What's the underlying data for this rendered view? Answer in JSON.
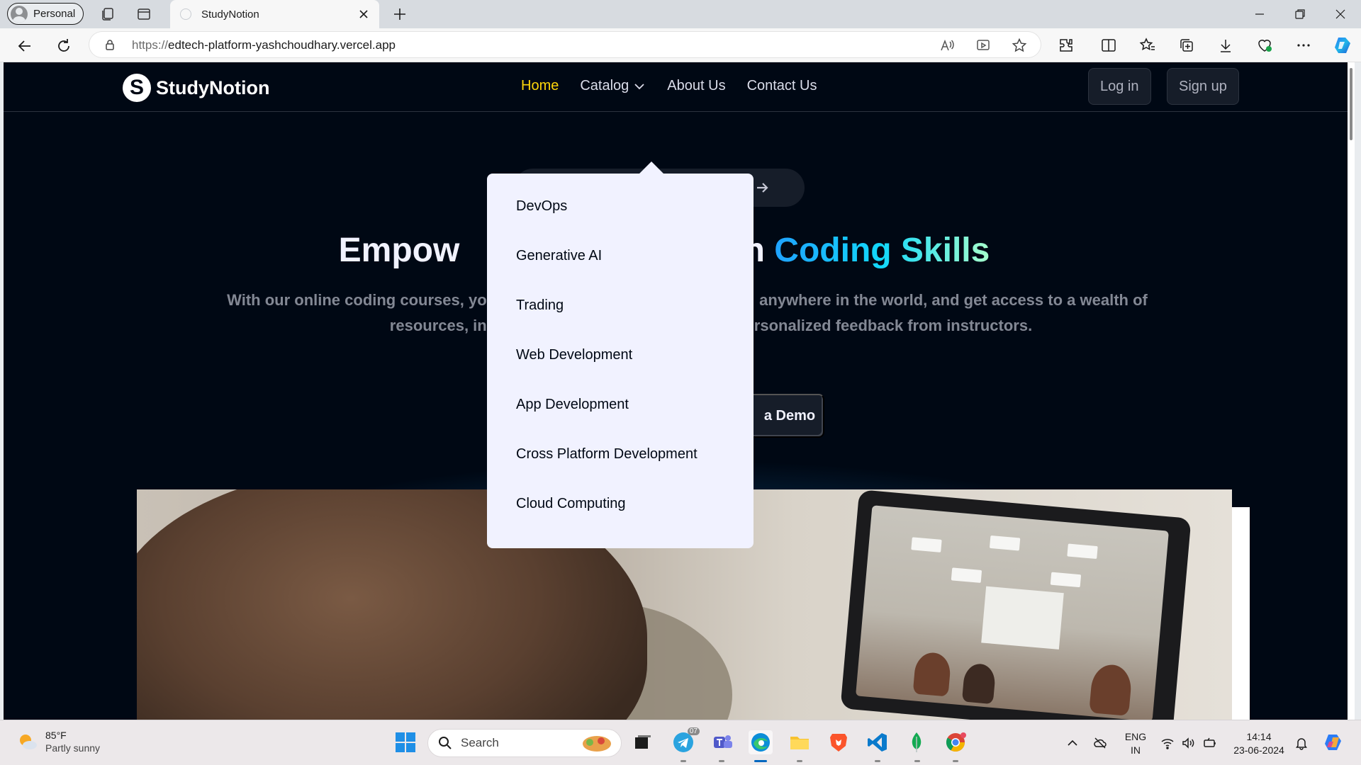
{
  "browser": {
    "profile_label": "Personal",
    "tab_title": "StudyNotion",
    "url_protocol": "https://",
    "url_host": "edtech-platform-yashchoudhary.vercel.app"
  },
  "site": {
    "logo_letter": "S",
    "brand_name": "StudyNotion",
    "nav": {
      "home": "Home",
      "catalog": "Catalog",
      "about": "About Us",
      "contact": "Contact Us"
    },
    "login_label": "Log in",
    "signup_label": "Sign up"
  },
  "catalog_menu": [
    "DevOps",
    "Generative AI",
    "Trading",
    "Web Development",
    "App Development",
    "Cross Platform Development",
    "Cloud Computing"
  ],
  "hero": {
    "headline_before": "Empow",
    "headline_after": "th ",
    "headline_gradient": "Coding Skills",
    "subtitle_line1": "With our online coding courses, you",
    "subtitle_gap1": " ",
    "subtitle_line1_end": "anywhere in the world, and get access to a wealth of",
    "subtitle_line2": "resources, including h",
    "subtitle_line2_end": "rsonalized feedback from instructors.",
    "cta_secondary_partial": "a Demo"
  },
  "taskbar": {
    "weather_temp": "85°F",
    "weather_condition": "Partly sunny",
    "search_label": "Search",
    "lang_line1": "ENG",
    "lang_line2": "IN",
    "time": "14:14",
    "date": "23-06-2024",
    "telegram_badge": "07"
  },
  "colors": {
    "page_bg": "#000814",
    "nav_active": "#ffd60a",
    "dropdown_bg": "#f1f2ff",
    "gradient_start": "#1fa2ff",
    "gradient_end": "#a6ffcb",
    "edge_blue": "#0067c0"
  }
}
